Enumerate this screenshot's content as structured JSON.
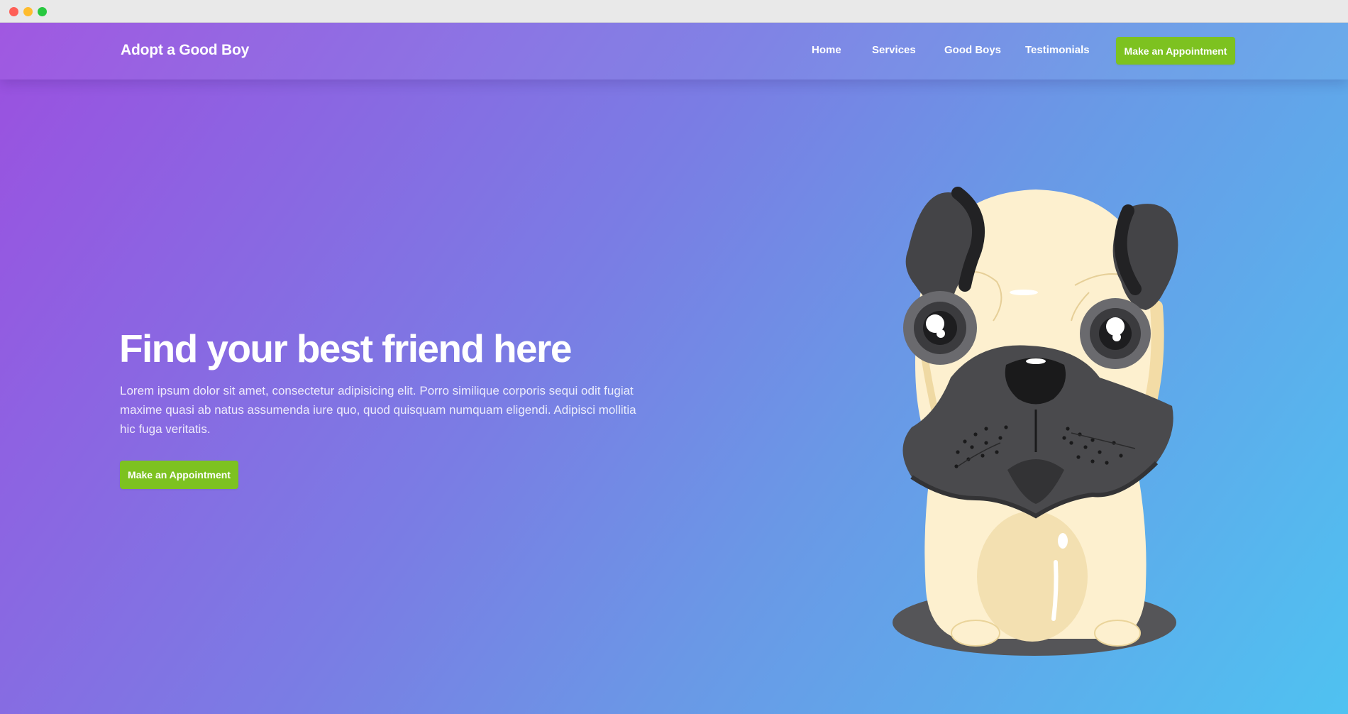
{
  "window": {
    "controls": [
      "close",
      "minimize",
      "zoom"
    ]
  },
  "navbar": {
    "brand": "Adopt a Good Boy",
    "links": [
      {
        "label": "Home"
      },
      {
        "label": "Services"
      },
      {
        "label": "Good Boys"
      },
      {
        "label": "Testimonials"
      }
    ],
    "cta_label": "Make an Appointment"
  },
  "hero": {
    "title": "Find your best friend here",
    "text": "Lorem ipsum dolor sit amet, consectetur adipisicing elit. Porro similique corporis sequi odit fugiat maxime quasi ab natus assumenda iure quo, quod quisquam numquam eligendi. Adipisci mollitia hic fuga veritatis.",
    "cta_label": "Make an Appointment",
    "illustration": "pug-illustration"
  },
  "colors": {
    "gradient_start": "#9b50e0",
    "gradient_end": "#4fc2f1",
    "button_green": "#7dc220"
  }
}
